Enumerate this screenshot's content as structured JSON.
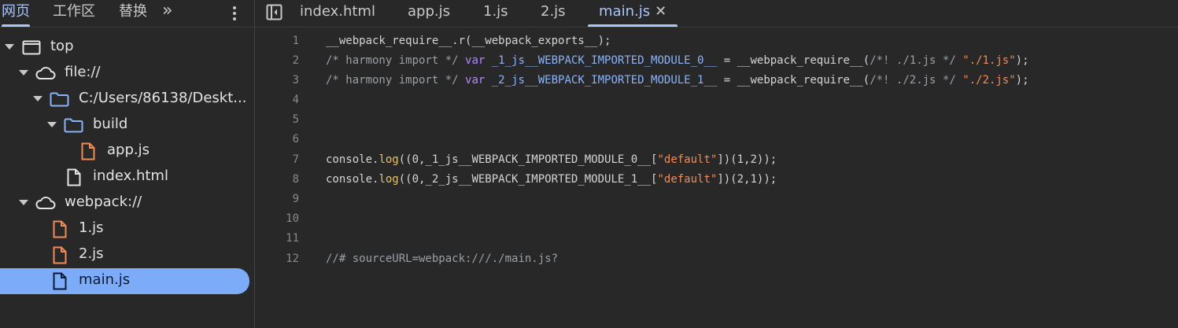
{
  "sidebar": {
    "tabs": [
      "网页",
      "工作区",
      "替换"
    ],
    "more": "»",
    "tree": [
      {
        "label": "top",
        "icon": "frame-icon"
      },
      {
        "label": "file://",
        "icon": "cloud-icon"
      },
      {
        "label": "C:/Users/86138/Deskt...",
        "icon": "folder-icon"
      },
      {
        "label": "build",
        "icon": "folder-icon"
      },
      {
        "label": "app.js",
        "icon": "js-file-icon"
      },
      {
        "label": "index.html",
        "icon": "file-icon"
      },
      {
        "label": "webpack://",
        "icon": "cloud-icon"
      },
      {
        "label": "1.js",
        "icon": "js-file-icon"
      },
      {
        "label": "2.js",
        "icon": "js-file-icon"
      },
      {
        "label": "main.js",
        "icon": "file-icon"
      }
    ]
  },
  "editor": {
    "tabs": [
      "index.html",
      "app.js",
      "1.js",
      "2.js",
      "main.js"
    ],
    "active_tab": "main.js",
    "close": "✕",
    "line_numbers": [
      "1",
      "2",
      "3",
      "4",
      "5",
      "6",
      "7",
      "8",
      "9",
      "10",
      "11",
      "12"
    ],
    "lines": {
      "l1": "__webpack_require__.r(__webpack_exports__);",
      "l2_cm": "/* harmony import */ ",
      "l2_kw": "var",
      "l2_var": "_1_js__WEBPACK_IMPORTED_MODULE_0__",
      "l2_mid": " = __webpack_require__(",
      "l2_cm2": "/*! ./1.js */",
      "l2_str": "\"./1.js\"",
      "l2_end": ");",
      "l3_cm": "/* harmony import */ ",
      "l3_kw": "var",
      "l3_var": "_2_js__WEBPACK_IMPORTED_MODULE_1__",
      "l3_mid": " = __webpack_require__(",
      "l3_cm2": "/*! ./2.js */",
      "l3_str": "\"./2.js\"",
      "l3_end": ");",
      "l7_a": "console.",
      "l7_fn": "log",
      "l7_b": "((0,_1_js__WEBPACK_IMPORTED_MODULE_0__[",
      "l7_str": "\"default\"",
      "l7_c": "])(1,2));",
      "l8_a": "console.",
      "l8_fn": "log",
      "l8_b": "((0,_2_js__WEBPACK_IMPORTED_MODULE_1__[",
      "l8_str": "\"default\"",
      "l8_c": "])(2,1));",
      "l12": "//# sourceURL=webpack:///./main.js?"
    }
  },
  "colors": {
    "accent": "#a8c7fa",
    "selected_row": "#7cacf8",
    "js_icon": "#f28b54",
    "folder_icon": "#8ab4f8"
  }
}
